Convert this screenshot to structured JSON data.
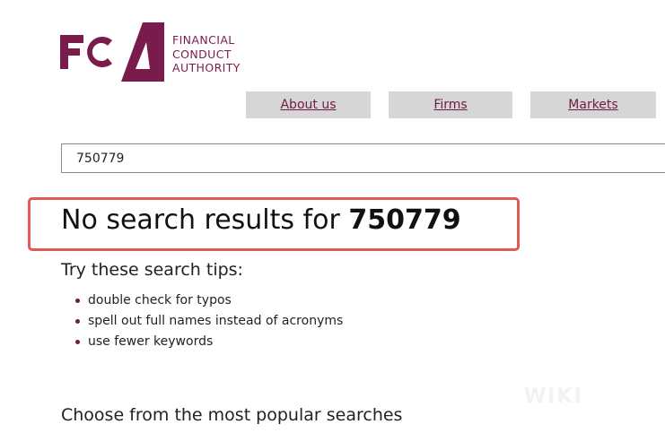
{
  "logo": {
    "letters": "FCA",
    "line1": "FINANCIAL",
    "line2": "CONDUCT",
    "line3": "AUTHORITY",
    "brand_color": "#7a1c4b"
  },
  "nav": {
    "items": [
      {
        "label": "About us"
      },
      {
        "label": "Firms"
      },
      {
        "label": "Markets"
      }
    ],
    "bg_color": "#d6d6d6"
  },
  "search": {
    "value": "750779"
  },
  "results": {
    "prefix": "No search results for",
    "query": "750779",
    "highlight_color": "#de5b55"
  },
  "tips": {
    "heading": "Try these search tips:",
    "items": [
      "double check for typos",
      "spell out full names instead of acronyms",
      "use fewer keywords"
    ]
  },
  "popular": {
    "heading": "Choose from the most popular searches"
  },
  "watermark": {
    "text": "WIKI"
  }
}
